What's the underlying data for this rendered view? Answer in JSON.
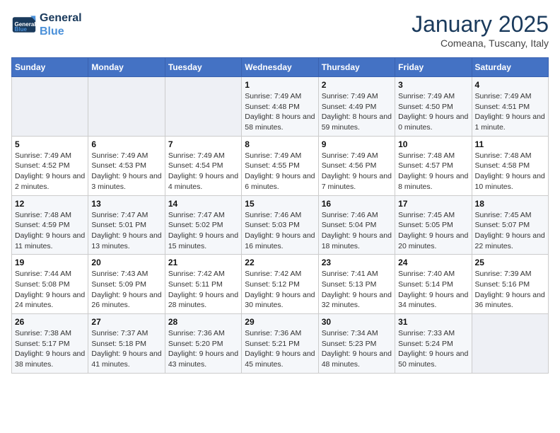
{
  "header": {
    "logo_line1": "General",
    "logo_line2": "Blue",
    "title": "January 2025",
    "subtitle": "Comeana, Tuscany, Italy"
  },
  "days_of_week": [
    "Sunday",
    "Monday",
    "Tuesday",
    "Wednesday",
    "Thursday",
    "Friday",
    "Saturday"
  ],
  "weeks": [
    [
      {
        "day": "",
        "info": ""
      },
      {
        "day": "",
        "info": ""
      },
      {
        "day": "",
        "info": ""
      },
      {
        "day": "1",
        "info": "Sunrise: 7:49 AM\nSunset: 4:48 PM\nDaylight: 8 hours and 58 minutes."
      },
      {
        "day": "2",
        "info": "Sunrise: 7:49 AM\nSunset: 4:49 PM\nDaylight: 8 hours and 59 minutes."
      },
      {
        "day": "3",
        "info": "Sunrise: 7:49 AM\nSunset: 4:50 PM\nDaylight: 9 hours and 0 minutes."
      },
      {
        "day": "4",
        "info": "Sunrise: 7:49 AM\nSunset: 4:51 PM\nDaylight: 9 hours and 1 minute."
      }
    ],
    [
      {
        "day": "5",
        "info": "Sunrise: 7:49 AM\nSunset: 4:52 PM\nDaylight: 9 hours and 2 minutes."
      },
      {
        "day": "6",
        "info": "Sunrise: 7:49 AM\nSunset: 4:53 PM\nDaylight: 9 hours and 3 minutes."
      },
      {
        "day": "7",
        "info": "Sunrise: 7:49 AM\nSunset: 4:54 PM\nDaylight: 9 hours and 4 minutes."
      },
      {
        "day": "8",
        "info": "Sunrise: 7:49 AM\nSunset: 4:55 PM\nDaylight: 9 hours and 6 minutes."
      },
      {
        "day": "9",
        "info": "Sunrise: 7:49 AM\nSunset: 4:56 PM\nDaylight: 9 hours and 7 minutes."
      },
      {
        "day": "10",
        "info": "Sunrise: 7:48 AM\nSunset: 4:57 PM\nDaylight: 9 hours and 8 minutes."
      },
      {
        "day": "11",
        "info": "Sunrise: 7:48 AM\nSunset: 4:58 PM\nDaylight: 9 hours and 10 minutes."
      }
    ],
    [
      {
        "day": "12",
        "info": "Sunrise: 7:48 AM\nSunset: 4:59 PM\nDaylight: 9 hours and 11 minutes."
      },
      {
        "day": "13",
        "info": "Sunrise: 7:47 AM\nSunset: 5:01 PM\nDaylight: 9 hours and 13 minutes."
      },
      {
        "day": "14",
        "info": "Sunrise: 7:47 AM\nSunset: 5:02 PM\nDaylight: 9 hours and 15 minutes."
      },
      {
        "day": "15",
        "info": "Sunrise: 7:46 AM\nSunset: 5:03 PM\nDaylight: 9 hours and 16 minutes."
      },
      {
        "day": "16",
        "info": "Sunrise: 7:46 AM\nSunset: 5:04 PM\nDaylight: 9 hours and 18 minutes."
      },
      {
        "day": "17",
        "info": "Sunrise: 7:45 AM\nSunset: 5:05 PM\nDaylight: 9 hours and 20 minutes."
      },
      {
        "day": "18",
        "info": "Sunrise: 7:45 AM\nSunset: 5:07 PM\nDaylight: 9 hours and 22 minutes."
      }
    ],
    [
      {
        "day": "19",
        "info": "Sunrise: 7:44 AM\nSunset: 5:08 PM\nDaylight: 9 hours and 24 minutes."
      },
      {
        "day": "20",
        "info": "Sunrise: 7:43 AM\nSunset: 5:09 PM\nDaylight: 9 hours and 26 minutes."
      },
      {
        "day": "21",
        "info": "Sunrise: 7:42 AM\nSunset: 5:11 PM\nDaylight: 9 hours and 28 minutes."
      },
      {
        "day": "22",
        "info": "Sunrise: 7:42 AM\nSunset: 5:12 PM\nDaylight: 9 hours and 30 minutes."
      },
      {
        "day": "23",
        "info": "Sunrise: 7:41 AM\nSunset: 5:13 PM\nDaylight: 9 hours and 32 minutes."
      },
      {
        "day": "24",
        "info": "Sunrise: 7:40 AM\nSunset: 5:14 PM\nDaylight: 9 hours and 34 minutes."
      },
      {
        "day": "25",
        "info": "Sunrise: 7:39 AM\nSunset: 5:16 PM\nDaylight: 9 hours and 36 minutes."
      }
    ],
    [
      {
        "day": "26",
        "info": "Sunrise: 7:38 AM\nSunset: 5:17 PM\nDaylight: 9 hours and 38 minutes."
      },
      {
        "day": "27",
        "info": "Sunrise: 7:37 AM\nSunset: 5:18 PM\nDaylight: 9 hours and 41 minutes."
      },
      {
        "day": "28",
        "info": "Sunrise: 7:36 AM\nSunset: 5:20 PM\nDaylight: 9 hours and 43 minutes."
      },
      {
        "day": "29",
        "info": "Sunrise: 7:36 AM\nSunset: 5:21 PM\nDaylight: 9 hours and 45 minutes."
      },
      {
        "day": "30",
        "info": "Sunrise: 7:34 AM\nSunset: 5:23 PM\nDaylight: 9 hours and 48 minutes."
      },
      {
        "day": "31",
        "info": "Sunrise: 7:33 AM\nSunset: 5:24 PM\nDaylight: 9 hours and 50 minutes."
      },
      {
        "day": "",
        "info": ""
      }
    ]
  ]
}
